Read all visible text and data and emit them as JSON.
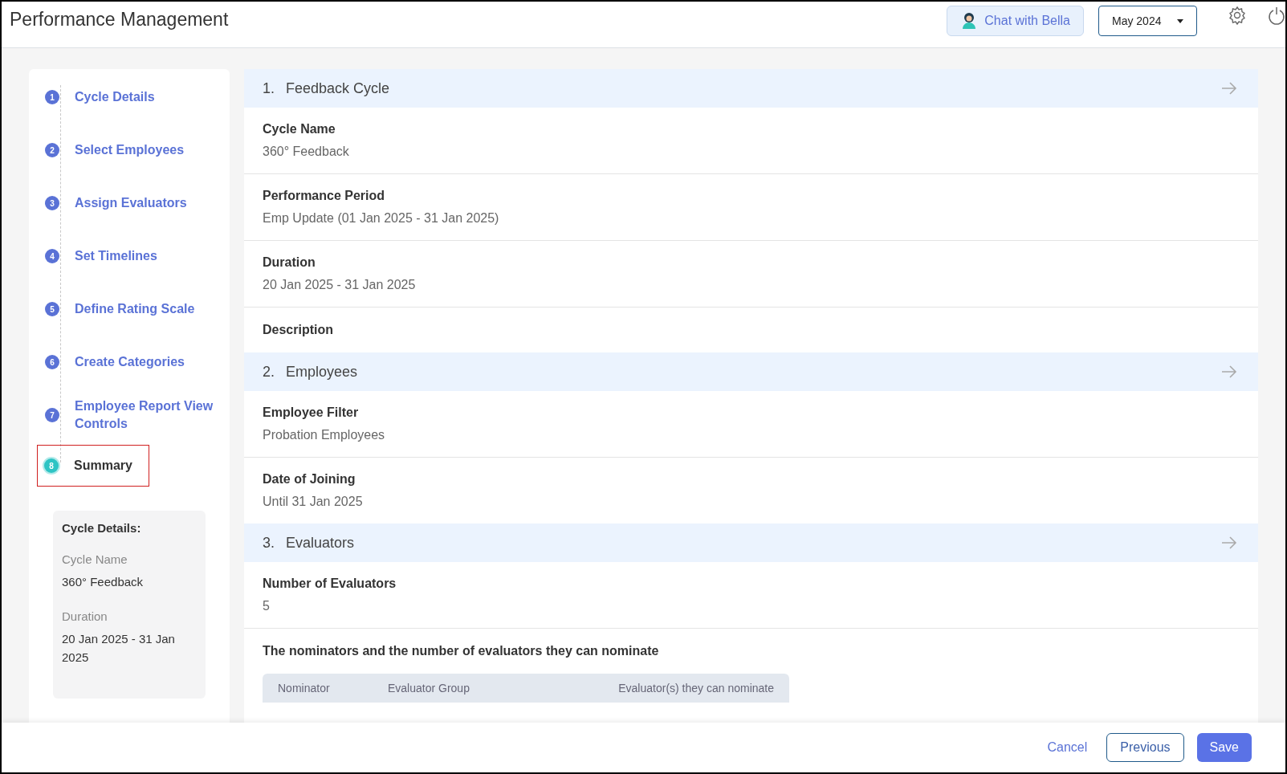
{
  "header": {
    "title": "Performance Management",
    "chat_button": "Chat with Bella",
    "period_select": "May 2024"
  },
  "steps": [
    {
      "number": "1",
      "label": "Cycle Details",
      "selected": false
    },
    {
      "number": "2",
      "label": "Select Employees",
      "selected": false
    },
    {
      "number": "3",
      "label": "Assign Evaluators",
      "selected": false
    },
    {
      "number": "4",
      "label": "Set Timelines",
      "selected": false
    },
    {
      "number": "5",
      "label": "Define Rating Scale",
      "selected": false
    },
    {
      "number": "6",
      "label": "Create Categories",
      "selected": false
    },
    {
      "number": "7",
      "label": "Employee Report View Controls",
      "selected": false
    },
    {
      "number": "8",
      "label": "Summary",
      "selected": true
    }
  ],
  "summary_panel": {
    "title": "Cycle Details:",
    "fields": [
      {
        "label": "Cycle Name",
        "value": "360° Feedback"
      },
      {
        "label": "Duration",
        "value": "20 Jan 2025 - 31 Jan 2025"
      }
    ]
  },
  "sections": [
    {
      "number": "1.",
      "title": "Feedback Cycle",
      "fields": [
        {
          "label": "Cycle Name",
          "value": "360° Feedback"
        },
        {
          "label": "Performance Period",
          "value": "Emp Update (01 Jan 2025 - 31 Jan 2025)"
        },
        {
          "label": "Duration",
          "value": "20 Jan 2025 - 31 Jan 2025"
        },
        {
          "label": "Description"
        }
      ]
    },
    {
      "number": "2.",
      "title": "Employees",
      "fields": [
        {
          "label": "Employee Filter",
          "value": "Probation Employees"
        },
        {
          "label": "Date of Joining",
          "value": "Until 31 Jan 2025"
        }
      ]
    },
    {
      "number": "3.",
      "title": "Evaluators",
      "fields": [
        {
          "label": "Number of Evaluators",
          "value": "5"
        }
      ],
      "table": {
        "title": "The nominators and the number of evaluators they can nominate",
        "columns": [
          "Nominator",
          "Evaluator Group",
          "Evaluator(s) they can nominate"
        ]
      }
    }
  ],
  "footer": {
    "cancel": "Cancel",
    "previous": "Previous",
    "save": "Save"
  }
}
